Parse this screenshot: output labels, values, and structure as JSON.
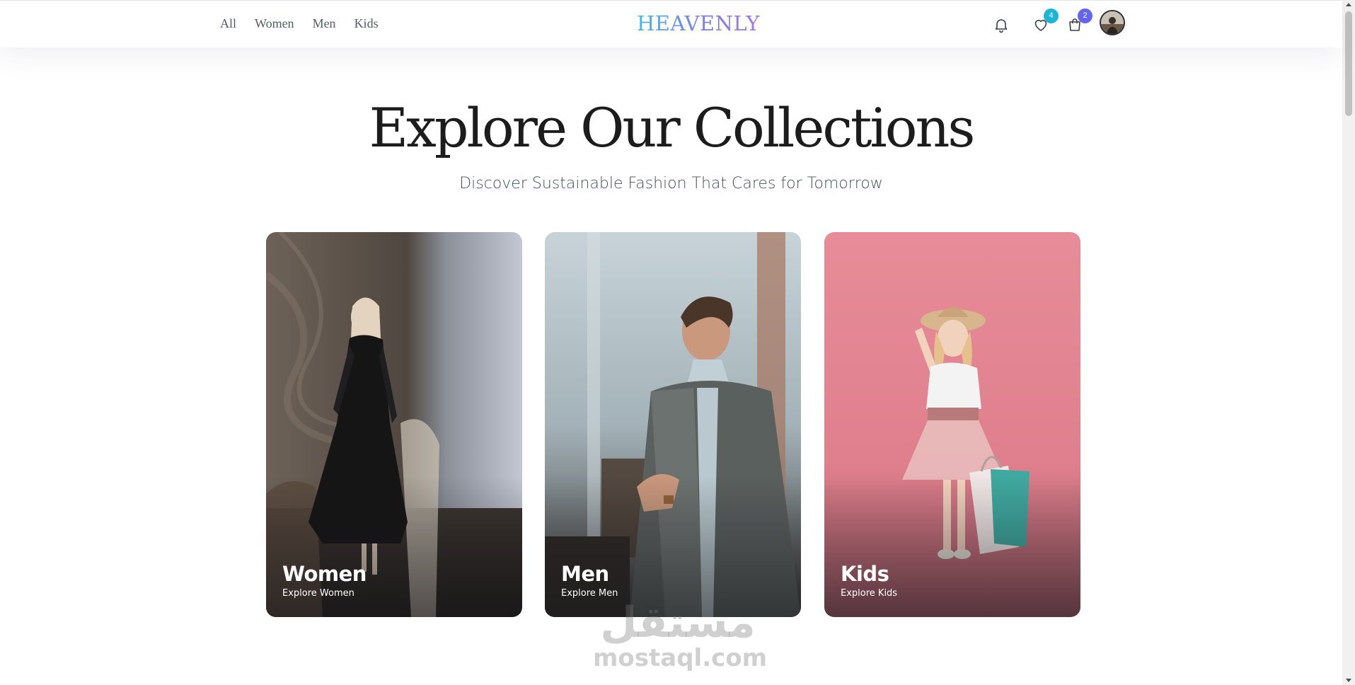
{
  "header": {
    "nav": [
      {
        "label": "All"
      },
      {
        "label": "Women"
      },
      {
        "label": "Men"
      },
      {
        "label": "Kids"
      }
    ],
    "logo": "HEAVENLY",
    "wishlist_count": "4",
    "cart_count": "2",
    "icons": {
      "notifications": "bell-icon",
      "wishlist": "heart-icon",
      "cart": "shopping-bag-icon",
      "profile": "avatar"
    },
    "colors": {
      "wishlist_badge": "#1cb5d6",
      "cart_badge": "#6365f0"
    }
  },
  "hero": {
    "title": "Explore Our Collections",
    "subtitle": "Discover Sustainable Fashion That Cares for Tomorrow"
  },
  "collections": [
    {
      "title": "Women",
      "link": "Explore Women"
    },
    {
      "title": "Men",
      "link": "Explore Men"
    },
    {
      "title": "Kids",
      "link": "Explore Kids"
    }
  ],
  "watermark": {
    "arabic": "مستقل",
    "latin": "mostaql.com"
  }
}
